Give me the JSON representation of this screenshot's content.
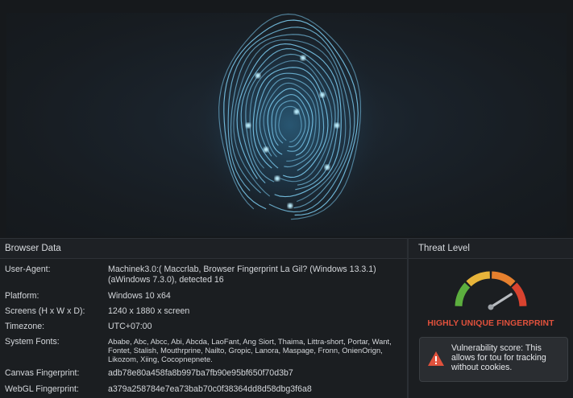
{
  "browser_data": {
    "title": "Browser Data",
    "rows": [
      {
        "label": "User-Agent:",
        "value": "Machinek3.0:( Maccrlab, Browser Fingerprint La Gil? (Windows 13.3.1) (aWindows 7.3.0), detected 16"
      },
      {
        "label": "Platform:",
        "value": "Windows 10 x64"
      },
      {
        "label": "Screens (H x W x D):",
        "value": "1240 x 1880 x screen"
      },
      {
        "label": "Timezone:",
        "value": "UTC+07:00"
      },
      {
        "label": "System Fonts:",
        "value": "Ababe, Abc, Abcc, Abi, Abcda, LaoFant, Ang Siort, Thaima, Littra-short, Portar, Want, Fontet, Stalish, Mouthrprine, Nailto, Gropic, Lanora, Maspage, Fronn, OnienOrign, Likozom, Xiing, Cocopnepnete."
      },
      {
        "label": "Canvas Fingerprint:",
        "value": "adb78e80a458fa8b997ba7fb90e95bf650f70d3b7"
      },
      {
        "label": "WebGL Fingerprint:",
        "value": "a379a258784e7ea73bab70c0f38364dd8d58dbg3f6a8"
      }
    ]
  },
  "threat": {
    "title": "Threat Level",
    "level_label": "HIGHLY UNIQUE FINGERPRINT",
    "gauge_level": 0.82,
    "alert_text": "Vulnerability score: This allows for tou for tracking without cookies.",
    "alert_icon": "warning-triangle-icon"
  },
  "colors": {
    "accent_blue": "#4fb6e6",
    "danger": "#e1513c",
    "gauge_green": "#5cae3e",
    "gauge_yellow": "#e7b43a",
    "gauge_orange": "#e6802e",
    "gauge_red": "#d9432f"
  }
}
